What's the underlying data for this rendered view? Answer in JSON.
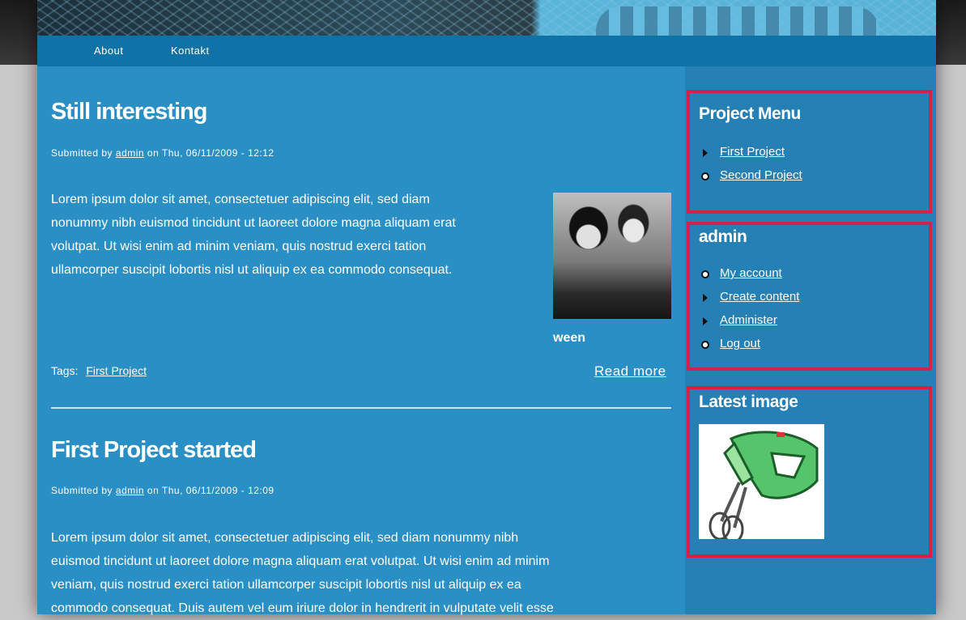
{
  "nav": {
    "items": [
      {
        "label": "About"
      },
      {
        "label": "Kontakt"
      }
    ]
  },
  "posts": [
    {
      "title": "Still interesting",
      "submitted_prefix": "Submitted by",
      "author": "admin",
      "submitted_date": "on Thu, 06/11/2009 - 12:12",
      "lines": [
        "Lorem ipsum dolor sit amet, consectetuer adipiscing elit, sed diam",
        "nonummy nibh euismod tincidunt ut laoreet dolore magna aliquam erat",
        "volutpat. Ut wisi enim ad minim veniam, quis nostrud exerci tation",
        "ullamcorper suscipit lobortis nisl ut aliquip ex ea commodo consequat."
      ],
      "image_caption": "ween",
      "tags_label": "Tags:",
      "tag": "First Project",
      "read_more": "Read more"
    },
    {
      "title": "First Project started",
      "submitted_prefix": "Submitted by",
      "author": "admin",
      "submitted_date": "on Thu, 06/11/2009 - 12:09",
      "lines": [
        "Lorem ipsum dolor sit amet, consectetuer adipiscing elit, sed diam nonummy nibh",
        "euismod tincidunt ut laoreet dolore magna aliquam erat volutpat. Ut wisi enim ad minim",
        "veniam, quis nostrud exerci tation ullamcorper suscipit lobortis nisl ut aliquip ex ea",
        "commodo consequat. Duis autem vel eum iriure dolor in hendrerit in vulputate velit esse"
      ]
    }
  ],
  "sidebar": {
    "project_menu": {
      "title": "Project Menu",
      "items": [
        {
          "label": "First Project",
          "bullet": "arrow"
        },
        {
          "label": "Second Project",
          "bullet": "dot"
        }
      ]
    },
    "user_menu": {
      "title": "admin",
      "items": [
        {
          "label": "My account",
          "bullet": "dot"
        },
        {
          "label": "Create content",
          "bullet": "arrow"
        },
        {
          "label": "Administer",
          "bullet": "arrow"
        },
        {
          "label": "Log out",
          "bullet": "dot"
        }
      ]
    },
    "latest_image": {
      "title": "Latest image",
      "image_icon": "hand-mixer-icon"
    }
  },
  "colors": {
    "page_bg": "#2a8fc4",
    "sidebar_bg": "#2580b5",
    "nav_bg": "#0f73a8",
    "highlight_border": "#d4204c"
  }
}
